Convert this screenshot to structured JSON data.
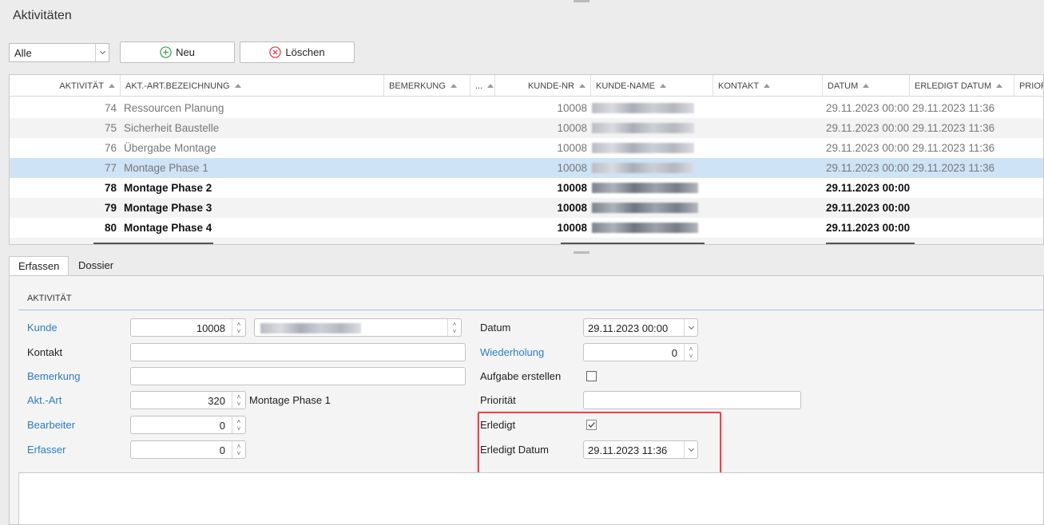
{
  "window": {
    "title": "Aktivitäten"
  },
  "toolbar": {
    "filter_value": "Alle",
    "new_label": "Neu",
    "delete_label": "Löschen"
  },
  "grid": {
    "headers": {
      "aktivitaet": "AKTIVITÄT",
      "bezeichnung": "AKT.-ART.BEZEICHNUNG",
      "bemerkung": "BEMERKUNG",
      "more": "...",
      "kunde_nr": "KUNDE-NR",
      "kunde_name": "KUNDE-NAME",
      "kontakt": "KONTAKT",
      "datum": "DATUM",
      "erledigt_datum": "ERLEDIGT DATUM",
      "prioritaet": "PRIOR"
    },
    "rows": [
      {
        "id": "74",
        "name": "Ressourcen Planung",
        "kunde_nr": "10008",
        "datum": "29.11.2023 00:00",
        "erledigt": "29.11.2023 11:36"
      },
      {
        "id": "75",
        "name": "Sicherheit Baustelle",
        "kunde_nr": "10008",
        "datum": "29.11.2023 00:00",
        "erledigt": "29.11.2023 11:36"
      },
      {
        "id": "76",
        "name": "Übergabe Montage",
        "kunde_nr": "10008",
        "datum": "29.11.2023 00:00",
        "erledigt": "29.11.2023 11:36"
      },
      {
        "id": "77",
        "name": "Montage Phase 1",
        "kunde_nr": "10008",
        "datum": "29.11.2023 00:00",
        "erledigt": "29.11.2023 11:36"
      },
      {
        "id": "78",
        "name": "Montage Phase 2",
        "kunde_nr": "10008",
        "datum": "29.11.2023 00:00",
        "erledigt": ""
      },
      {
        "id": "79",
        "name": "Montage Phase 3",
        "kunde_nr": "10008",
        "datum": "29.11.2023 00:00",
        "erledigt": ""
      },
      {
        "id": "80",
        "name": "Montage Phase 4",
        "kunde_nr": "10008",
        "datum": "29.11.2023 00:00",
        "erledigt": ""
      }
    ]
  },
  "tabs": {
    "erfassen": "Erfassen",
    "dossier": "Dossier"
  },
  "form": {
    "group_title": "AKTIVITÄT",
    "kunde_label": "Kunde",
    "kunde_value": "10008",
    "kontakt_label": "Kontakt",
    "bemerkung_label": "Bemerkung",
    "aktart_label": "Akt.-Art",
    "aktart_value": "320",
    "aktart_name": "Montage Phase 1",
    "bearbeiter_label": "Bearbeiter",
    "bearbeiter_value": "0",
    "erfasser_label": "Erfasser",
    "erfasser_value": "0",
    "datum_label": "Datum",
    "datum_value": "29.11.2023 00:00",
    "wiederholung_label": "Wiederholung",
    "wiederholung_value": "0",
    "aufgabe_label": "Aufgabe erstellen",
    "prioritaet_label": "Priorität",
    "erledigt_label": "Erledigt",
    "erledigt_datum_label": "Erledigt Datum",
    "erledigt_datum_value": "29.11.2023 11:36"
  },
  "colors": {
    "link": "#2e7dc1",
    "selection": "#cfe3f7",
    "highlight": "#e5484d"
  }
}
